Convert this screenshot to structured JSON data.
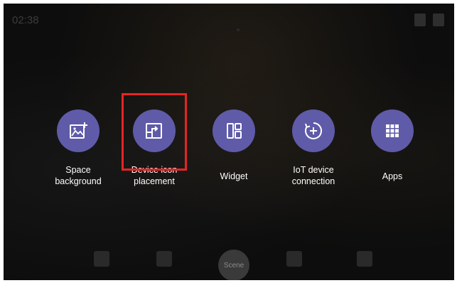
{
  "status_bar": {
    "time": "02:38"
  },
  "menu": {
    "items": [
      {
        "id": "space-background",
        "icon": "image-add-icon",
        "label_line1": "Space",
        "label_line2": "background"
      },
      {
        "id": "device-icon-placement",
        "icon": "move-icon",
        "label_line1": "Device icon",
        "label_line2": "placement"
      },
      {
        "id": "widget",
        "icon": "widget-grid-icon",
        "label_line1": "Widget",
        "label_line2": ""
      },
      {
        "id": "iot-device-connection",
        "icon": "plus-circle-icon",
        "label_line1": "IoT device",
        "label_line2": "connection"
      },
      {
        "id": "apps",
        "icon": "apps-grid-icon",
        "label_line1": "Apps",
        "label_line2": ""
      }
    ]
  },
  "dock": {
    "scene_label": "Scene"
  },
  "colors": {
    "button_circle": "#5f5ba8",
    "highlight": "#e52525",
    "background": "#0d0d0d"
  }
}
